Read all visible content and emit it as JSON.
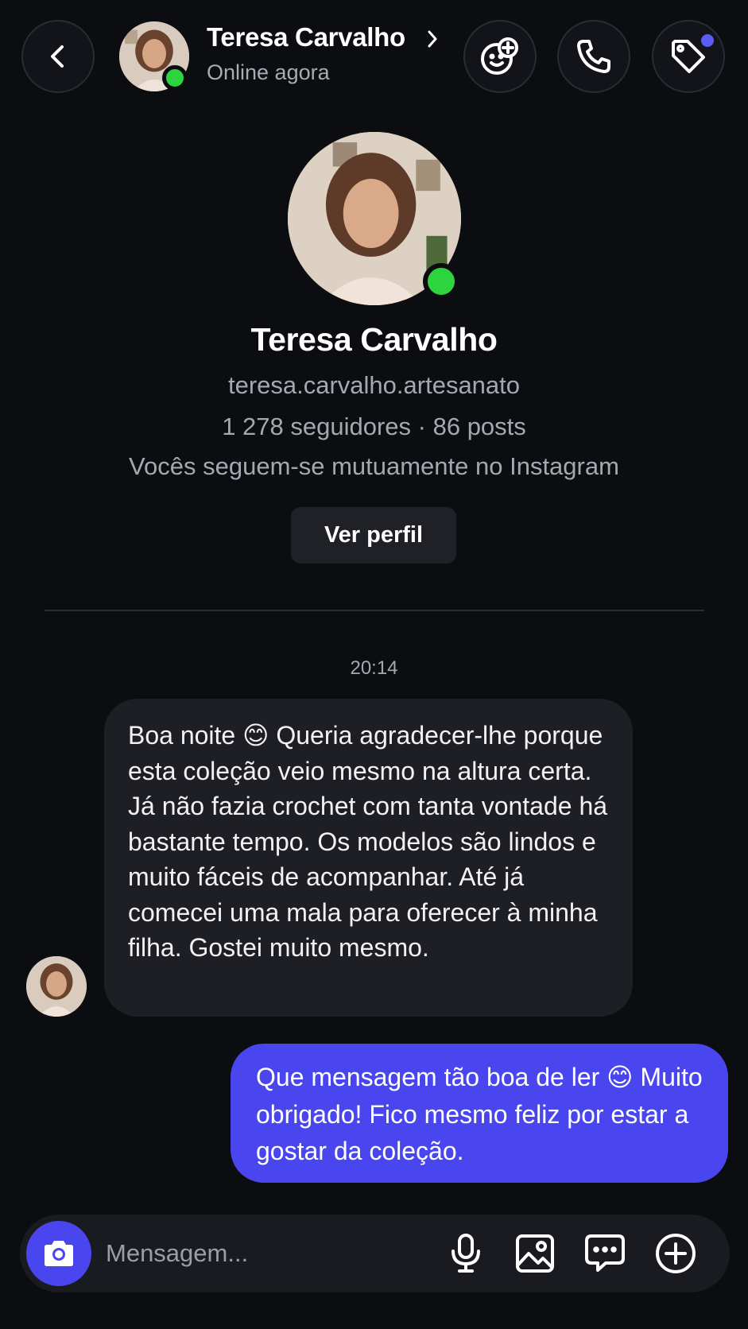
{
  "header": {
    "contact_name": "Teresa Carvalho",
    "status": "Online agora"
  },
  "profile": {
    "name": "Teresa Carvalho",
    "handle": "teresa.carvalho.artesanato",
    "stats": "1 278 seguidores · 86 posts",
    "mutual": "Vocês seguem-se mutuamente no Instagram",
    "view_profile_label": "Ver perfil"
  },
  "conversation": {
    "timestamp": "20:14",
    "messages": [
      {
        "direction": "incoming",
        "text": "Boa noite 😊 Queria agradecer-lhe porque esta coleção veio mesmo na altura certa. Já não fazia crochet com tanta vontade há bastante tempo. Os modelos são lindos e muito fáceis de acompanhar. Até já comecei uma mala para oferecer à minha filha. Gostei muito mesmo."
      },
      {
        "direction": "outgoing",
        "text": "Que mensagem tão boa de ler 😊 Muito obrigado! Fico mesmo feliz por estar a gostar da coleção."
      }
    ]
  },
  "composer": {
    "placeholder": "Mensagem..."
  },
  "icons": {
    "back": "chevron-left-icon",
    "sticker": "sticker-add-icon",
    "call": "phone-icon",
    "tag": "tag-icon",
    "camera": "camera-icon",
    "mic": "microphone-icon",
    "gallery": "image-icon",
    "chat": "chat-bubble-icon",
    "plus": "plus-circle-icon"
  },
  "colors": {
    "background": "#0c0d10",
    "accent": "#4a46ef",
    "online": "#2ed43d",
    "incoming_bubble": "#1e1f24",
    "secondary_text": "#a6a8b1"
  }
}
